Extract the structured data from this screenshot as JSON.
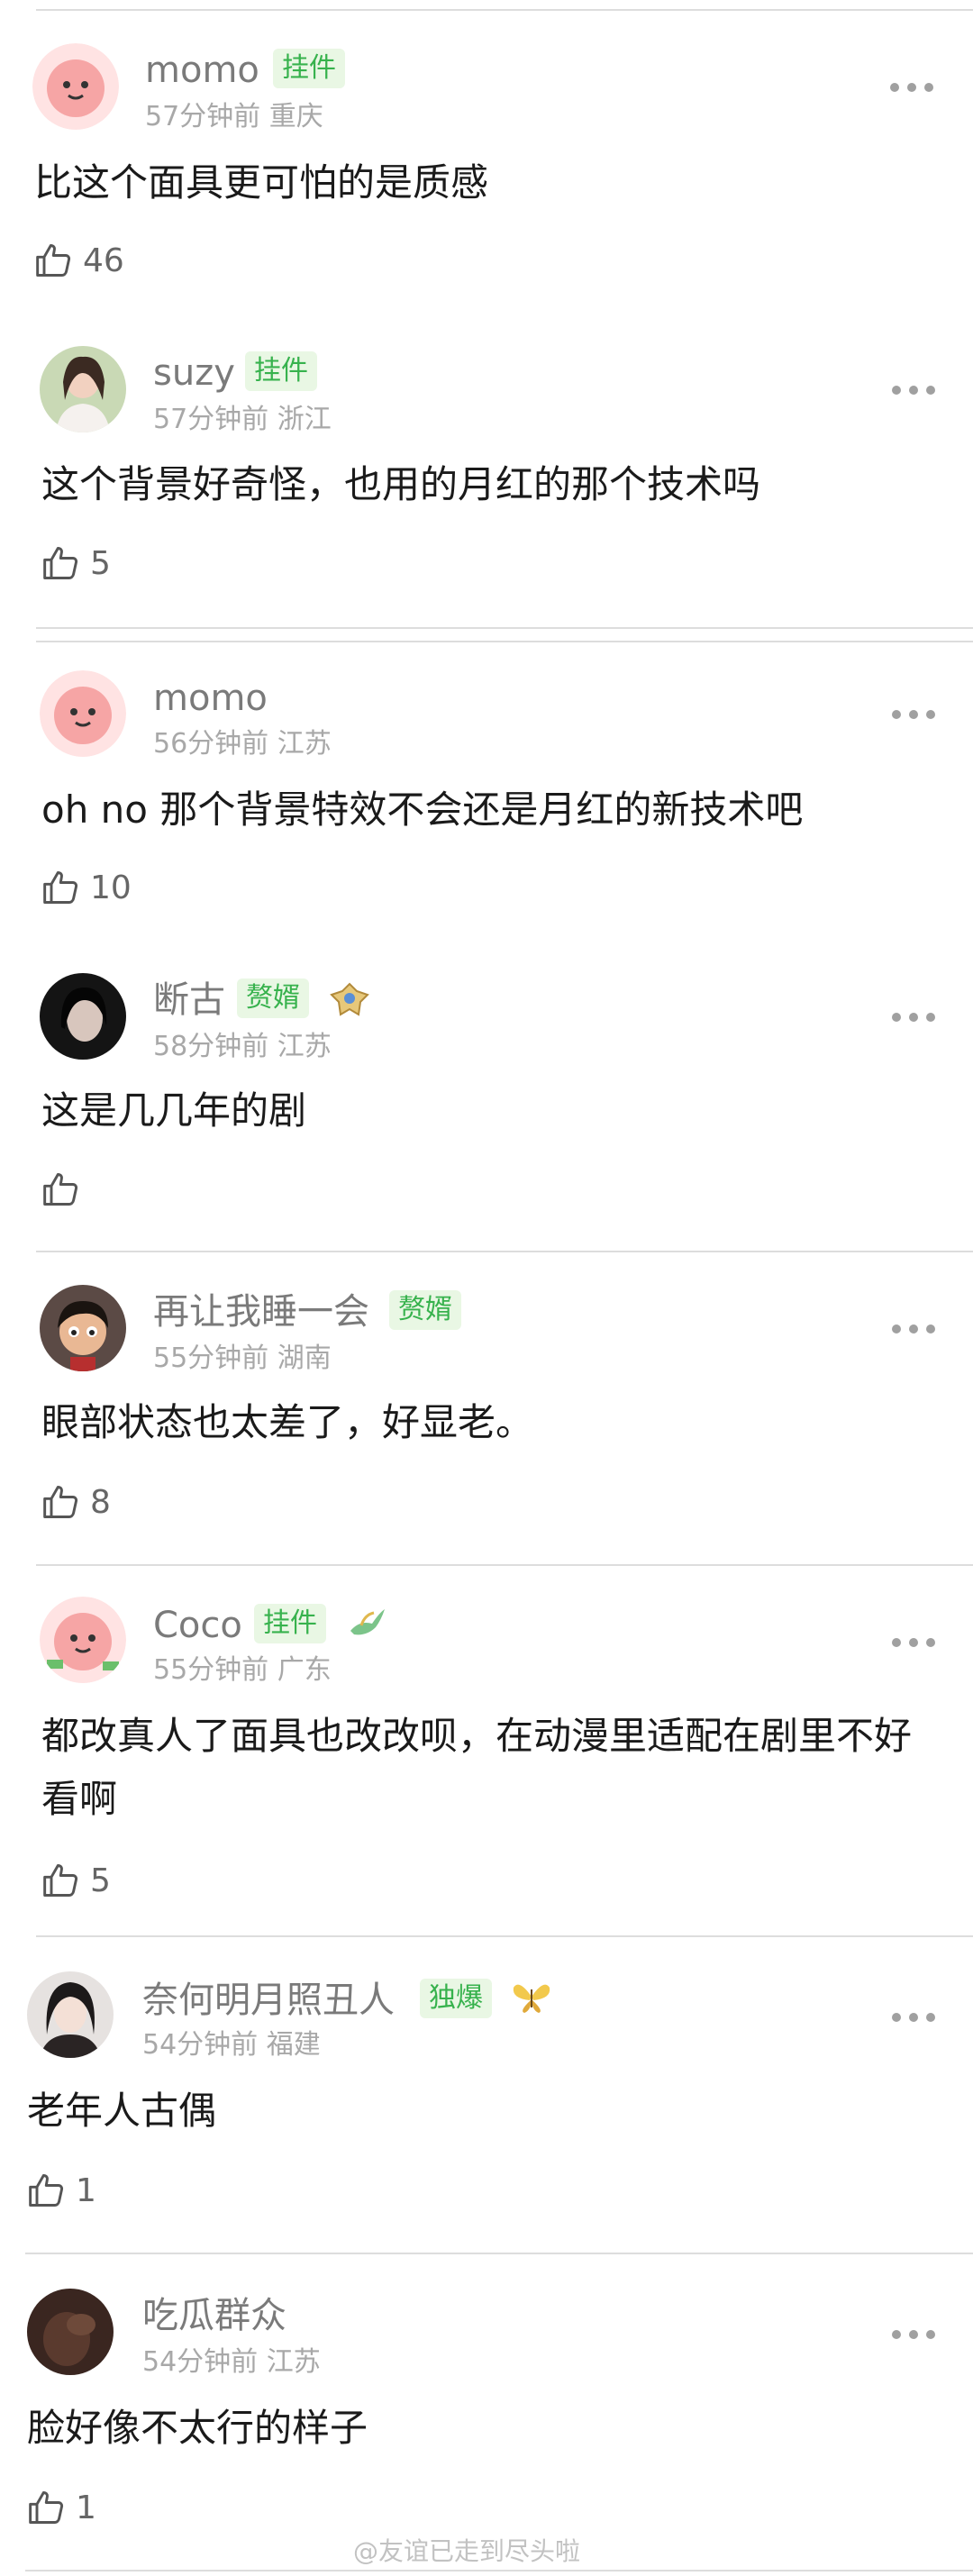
{
  "comments": [
    {
      "name": "momo",
      "badge": "挂件",
      "time": "57分钟前",
      "location": "重庆",
      "text": "比这个面具更可怕的是质感",
      "likes": "46",
      "avatar": "pink-cartoon-avatar"
    },
    {
      "name": "suzy",
      "badge": "挂件",
      "time": "57分钟前",
      "location": "浙江",
      "text": "这个背景好奇怪，也用的月红的那个技术吗",
      "likes": "5",
      "avatar": "photo-girl-avatar"
    },
    {
      "name": "momo",
      "badge": "",
      "time": "56分钟前",
      "location": "江苏",
      "text": "oh no 那个背景特效不会还是月红的新技术吧",
      "likes": "10",
      "avatar": "pink-cartoon-avatar"
    },
    {
      "name": "断古",
      "badge": "赘婿",
      "time": "58分钟前",
      "location": "江苏",
      "text": "这是几几年的剧",
      "likes": "",
      "avatar": "dark-portrait-avatar"
    },
    {
      "name": "再让我睡一会",
      "badge": "赘婿",
      "time": "55分钟前",
      "location": "湖南",
      "text": "眼部状态也太差了，好显老。",
      "likes": "8",
      "avatar": "cartoon-boy-avatar"
    },
    {
      "name": "Coco",
      "badge": "挂件",
      "time": "55分钟前",
      "location": "广东",
      "text": "都改真人了面具也改改呗，在动漫里适配在剧里不好看啊",
      "likes": "5",
      "avatar": "pink-cartoon-avatar"
    },
    {
      "name": "奈何明月照丑人",
      "badge": "独爆",
      "time": "54分钟前",
      "location": "福建",
      "text": "老年人古偶",
      "likes": "1",
      "avatar": "photo-woman-avatar"
    },
    {
      "name": "吃瓜群众",
      "badge": "",
      "time": "54分钟前",
      "location": "江苏",
      "text": "脸好像不太行的样子",
      "likes": "1",
      "avatar": "dark-brown-avatar"
    }
  ],
  "watermark": "@友谊已走到尽头啦",
  "icons": {
    "like": "thumbs-up-icon",
    "more": "more-dots-icon",
    "crest": "crest-icon",
    "bird": "bird-icon",
    "butterfly": "butterfly-icon"
  },
  "colors": {
    "badge_text": "#37b24d",
    "badge_bg": "#e9f7e4",
    "username": "#7a7a7a",
    "meta": "#a8a8a8"
  }
}
